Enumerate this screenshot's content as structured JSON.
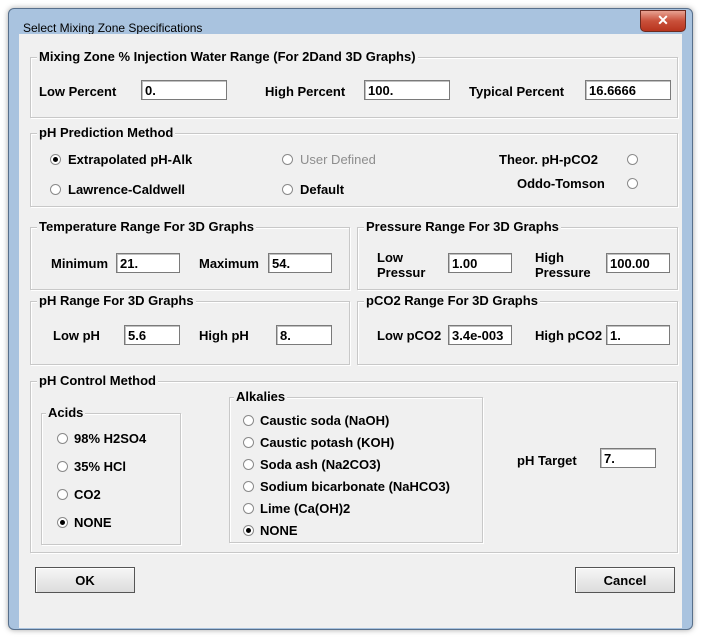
{
  "window": {
    "title": "Select Mixing Zone Specifications",
    "close_glyph": "✕"
  },
  "injection": {
    "legend": "Mixing Zone % Injection Water Range (For 2Dand 3D Graphs)",
    "low_label": "Low Percent",
    "low_value": "0.",
    "high_label": "High Percent",
    "high_value": "100.",
    "typical_label": "Typical Percent",
    "typical_value": "16.6666"
  },
  "ph_method": {
    "legend": "pH Prediction Method",
    "extrapolated": "Extrapolated pH-Alk",
    "user_defined": "User Defined",
    "theor": "Theor. pH-pCO2",
    "lawrence": "Lawrence-Caldwell",
    "default": "Default",
    "oddo": "Oddo-Tomson"
  },
  "temperature": {
    "legend": "Temperature Range For 3D Graphs",
    "min_label": "Minimum",
    "min_value": "21.",
    "max_label": "Maximum",
    "max_value": "54."
  },
  "pressure": {
    "legend": "Pressure Range For 3D Graphs",
    "low_label_1": "Low",
    "low_label_2": "Pressur",
    "low_value": "1.00",
    "high_label_1": "High",
    "high_label_2": "Pressure",
    "high_value": "100.00"
  },
  "ph_range": {
    "legend": "pH Range For 3D Graphs",
    "low_label": "Low pH",
    "low_value": "5.6",
    "high_label": "High pH",
    "high_value": "8."
  },
  "pco2_range": {
    "legend": "pCO2 Range For 3D Graphs",
    "low_label": "Low pCO2",
    "low_value": "3.4e-003",
    "high_label": "High pCO2",
    "high_value": "1."
  },
  "control": {
    "legend": "pH Control Method",
    "acids_legend": "Acids",
    "acids": [
      "98% H2SO4",
      "35% HCl",
      "CO2",
      "NONE"
    ],
    "alkalies_legend": "Alkalies",
    "alkalies": [
      "Caustic soda (NaOH)",
      "Caustic potash (KOH)",
      "Soda ash (Na2CO3)",
      "Sodium bicarbonate (NaHCO3)",
      "Lime (Ca(OH)2",
      "NONE"
    ],
    "target_label": "pH Target",
    "target_value": "7."
  },
  "buttons": {
    "ok": "OK",
    "cancel": "Cancel"
  }
}
